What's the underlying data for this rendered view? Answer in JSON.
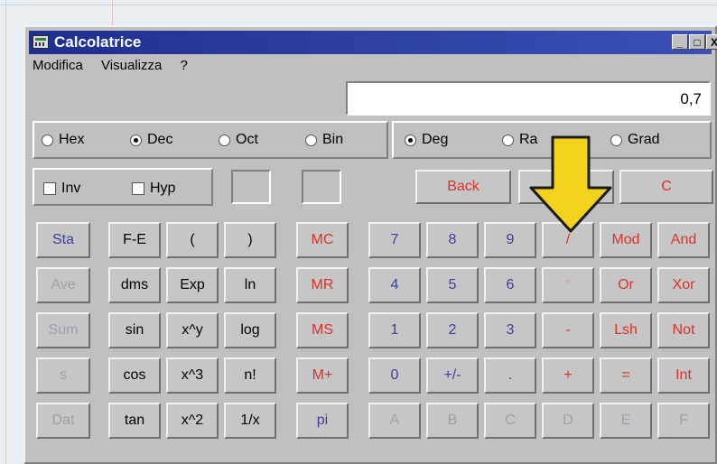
{
  "window": {
    "title": "Calcolatrice"
  },
  "titlebar_buttons": {
    "minimize": "_",
    "maximize": "□",
    "close": "X"
  },
  "menu": [
    "Modifica",
    "Visualizza",
    "?"
  ],
  "display": {
    "value": "0,7"
  },
  "number_base": {
    "options": [
      {
        "label": "Hex",
        "selected": false
      },
      {
        "label": "Dec",
        "selected": true
      },
      {
        "label": "Oct",
        "selected": false
      },
      {
        "label": "Bin",
        "selected": false
      }
    ]
  },
  "angle_units": {
    "options": [
      {
        "label": "Deg",
        "selected": true
      },
      {
        "label": "Ra",
        "selected": false
      },
      {
        "label": "Grad",
        "selected": false
      }
    ]
  },
  "checkboxes": [
    {
      "label": "Inv",
      "checked": false
    },
    {
      "label": "Hyp",
      "checked": false
    }
  ],
  "top_buttons": {
    "back": "Back",
    "clear": "C"
  },
  "keypad": {
    "stat": [
      "Sta",
      "Ave",
      "Sum",
      "s",
      "Dat"
    ],
    "sci1": [
      "F-E",
      "dms",
      "sin",
      "cos",
      "tan"
    ],
    "sci2": [
      "(",
      "Exp",
      "x^y",
      "x^3",
      "x^2"
    ],
    "sci3": [
      ")",
      "ln",
      "log",
      "n!",
      "1/x"
    ],
    "memory": [
      "MC",
      "MR",
      "MS",
      "M+",
      "pi"
    ],
    "digits_col1": [
      "7",
      "4",
      "1",
      "0",
      "A"
    ],
    "digits_col2": [
      "8",
      "5",
      "2",
      "+/-",
      "B"
    ],
    "digits_col3": [
      "9",
      "6",
      "3",
      ".",
      "C"
    ],
    "ops_col1": [
      "/",
      "*",
      "-",
      "+",
      "D"
    ],
    "ops_col2": [
      "Mod",
      "Or",
      "Lsh",
      "=",
      "E"
    ],
    "ops_col3": [
      "And",
      "Xor",
      "Not",
      "Int",
      "F"
    ]
  },
  "colors": {
    "title_blue": "#1f2f8e",
    "annotation_arrow": "#f2d21b"
  }
}
